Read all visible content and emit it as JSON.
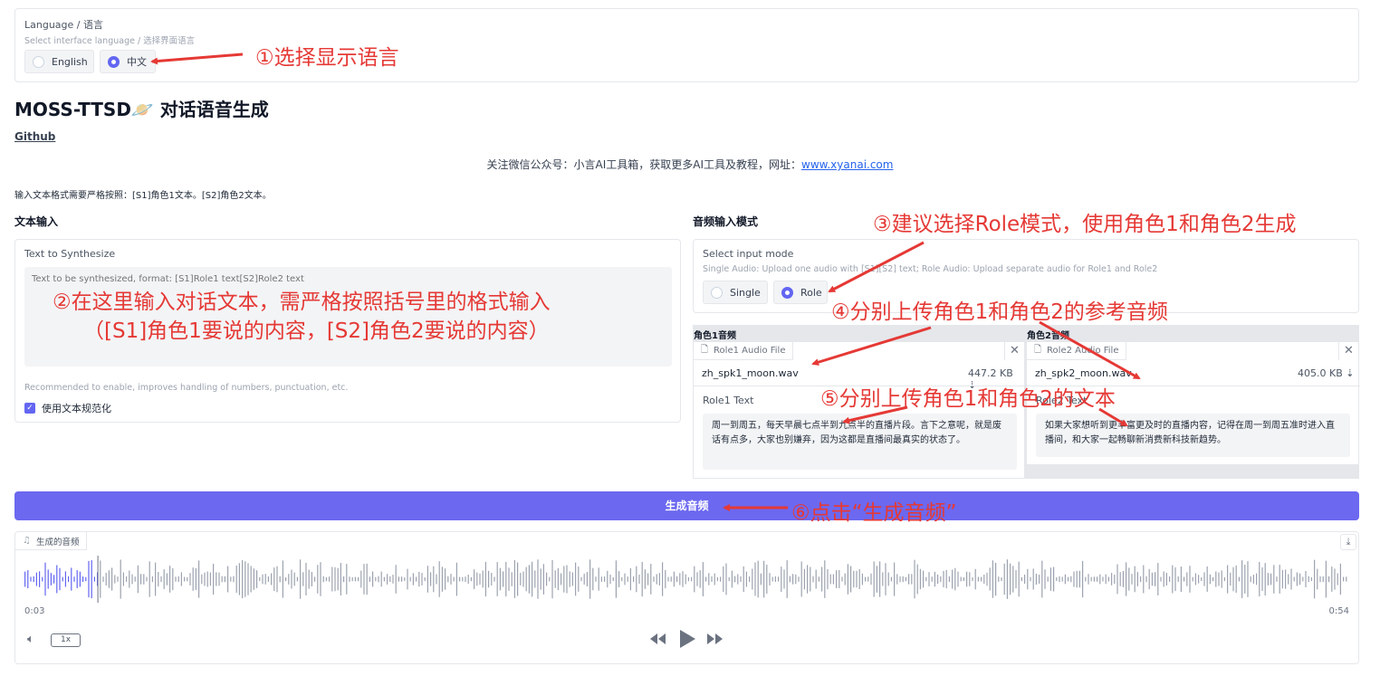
{
  "language": {
    "title": "Language / 语言",
    "subtitle": "Select interface language / 选择界面语言",
    "options": [
      "English",
      "中文"
    ],
    "selected": "中文"
  },
  "header": {
    "title": "MOSS-TTSD🪐 对话语音生成",
    "github_link": "Github",
    "notice_prefix": "关注微信公众号：小言AI工具箱，获取更多AI工具及教程，网址：",
    "notice_url": "www.xyanai.com",
    "format_hint": "输入文本格式需要严格按照：[S1]角色1文本。[S2]角色2文本。"
  },
  "text_input": {
    "section_title": "文本输入",
    "field_label": "Text to Synthesize",
    "placeholder": "Text to be synthesized, format: [S1]Role1 text[S2]Role2 text",
    "normalize_hint": "Recommended to enable, improves handling of numbers, punctuation, etc.",
    "normalize_label": "使用文本规范化",
    "normalize_checked": true
  },
  "audio_mode": {
    "section_title": "音频输入模式",
    "field_label": "Select input mode",
    "hint": "Single Audio: Upload one audio with [S1][S2] text; Role Audio: Upload separate audio for Role1 and Role2",
    "options": [
      "Single",
      "Role"
    ],
    "selected": "Role"
  },
  "roles": [
    {
      "header": "角色1音频",
      "file_tab": "Role1 Audio File",
      "file_name": "zh_spk1_moon.wav",
      "file_size": "447.2 KB ⇣",
      "text_label": "Role1 Text",
      "text": "周一到周五，每天早晨七点半到九点半的直播片段。言下之意呢，就是废话有点多，大家也别嫌弃，因为这都是直播间最真实的状态了。"
    },
    {
      "header": "角色2音频",
      "file_tab": "Role2 Audio File",
      "file_name": "zh_spk2_moon.wav",
      "file_size": "405.0 KB ⇣",
      "text_label": "Role2 Text",
      "text": "如果大家想听到更丰富更及时的直播内容，记得在周一到周五准时进入直播间，和大家一起畅聊新消费新科技新趋势。"
    }
  ],
  "generate_button": "生成音频",
  "output": {
    "tab_label": "生成的音频",
    "time_current": "0:03",
    "time_total": "0:54",
    "speed": "1x",
    "progress": 0.055
  },
  "annotations": {
    "a1": "①选择显示语言",
    "a2_line1": "②在这里输入对话文本，需严格按照括号里的格式输入",
    "a2_line2": "（[S1]角色1要说的内容，[S2]角色2要说的内容）",
    "a3": "③建议选择Role模式，使用角色1和角色2生成",
    "a4": "④分别上传角色1和角色2的参考音频",
    "a5": "⑤分别上传角色1和角色2的文本",
    "a6": "⑥点击“生成音频”"
  },
  "colors": {
    "accent": "#6366f1",
    "button": "#6c68f0",
    "annotation": "#e53935"
  }
}
